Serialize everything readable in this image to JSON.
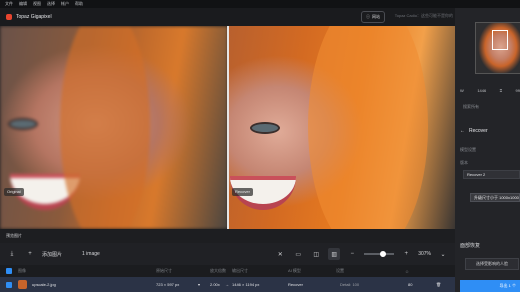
{
  "menu": [
    "文件",
    "编辑",
    "视图",
    "选择",
    "帐户",
    "帮助"
  ],
  "app": {
    "title": "Topaz Gigapixel",
    "web_button": "网站",
    "notice": "Topaz Cadio：这些可能不是你的"
  },
  "viewer": {
    "left_tag": "Original",
    "right_tag": "Recover"
  },
  "right_panel": {
    "zoom_value": "1446",
    "zoom_pct": "99",
    "small_label": "搜索所有",
    "section_title": "Recover",
    "model_label": "模型设置",
    "version_label": "版本",
    "selected_model": "Recover 2",
    "tooltip_text": "升级尺寸小于 1000x1000",
    "face_restore": "面部恢复",
    "face_button": "选择受影响的人脸",
    "export_label": "导出 1 个"
  },
  "bottom": {
    "preview_title": "预览图片",
    "add_image": "添加图片",
    "image_count": "1 image",
    "zoom_percent": "307%",
    "table_headers": [
      "图像",
      "原始尺寸",
      "放大倍数",
      "输出尺寸",
      "AI 模型",
      "设置",
      "预设"
    ],
    "row": {
      "filename": "upscale-2.jpg",
      "original": "723 × 597 px",
      "scale": "2.00x",
      "arrow": "→",
      "output": "1446 × 1194 px",
      "model": "Recover",
      "setting": "Detail: 100",
      "preset": "80"
    }
  },
  "colors": {
    "accent": "#2f8ef5",
    "brand": "#e8452f"
  }
}
